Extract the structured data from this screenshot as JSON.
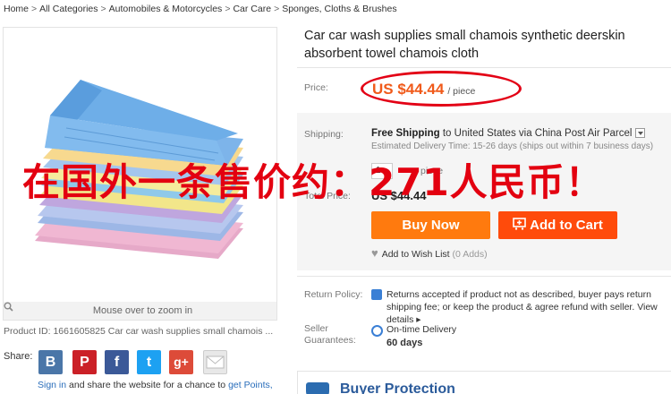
{
  "breadcrumb": [
    "Home",
    "All Categories",
    "Automobiles & Motorcycles",
    "Car Care",
    "Sponges, Cloths & Brushes"
  ],
  "breadcrumb_sep": ">",
  "product": {
    "title": "Car car wash supplies small chamois synthetic deerskin absorbent towel chamois cloth",
    "price_label": "Price:",
    "price": "US $44.44",
    "price_unit": "/ piece",
    "id_text": "Product ID: 1661605825 Car car wash supplies small chamois ..."
  },
  "image": {
    "zoom_hint": "Mouse over to zoom in"
  },
  "shipping": {
    "label": "Shipping:",
    "free": "Free Shipping",
    "to": " to United States via China Post Air Parcel",
    "estimate": "Estimated Delivery Time: 15-26 days (ships out within 7 business days)"
  },
  "quantity": {
    "value": "1",
    "unit": "piece"
  },
  "total": {
    "label": "Total Price:",
    "value": "US $44.44"
  },
  "buttons": {
    "buy_now": "Buy Now",
    "add_to_cart": "Add to Cart"
  },
  "wishlist": {
    "label": "Add to Wish List",
    "count": "(0 Adds)"
  },
  "return_policy": {
    "label": "Return Policy:",
    "text": "Returns accepted if product not as described, buyer pays return shipping fee; or keep the product & agree refund with seller.",
    "more": "View details ▸"
  },
  "guarantee": {
    "label": "Seller Guarantees:",
    "title": "On-time Delivery",
    "days": "60 days"
  },
  "protection": {
    "title": "Buyer Protection"
  },
  "share": {
    "label": "Share:",
    "buttons": [
      "B",
      "P",
      "f",
      "t",
      "g+",
      ""
    ],
    "signin_link": "Sign in",
    "signin_text": " and share the website for a chance to ",
    "points_link": "get Points,"
  },
  "overlay": {
    "text": "在国外一条售价约：271人民币！"
  },
  "colors": {
    "accent": "#f05a1a",
    "buy": "#ff7a0e",
    "cart": "#ff4b0b",
    "annotation": "#e30015",
    "link": "#2a6ebb"
  }
}
